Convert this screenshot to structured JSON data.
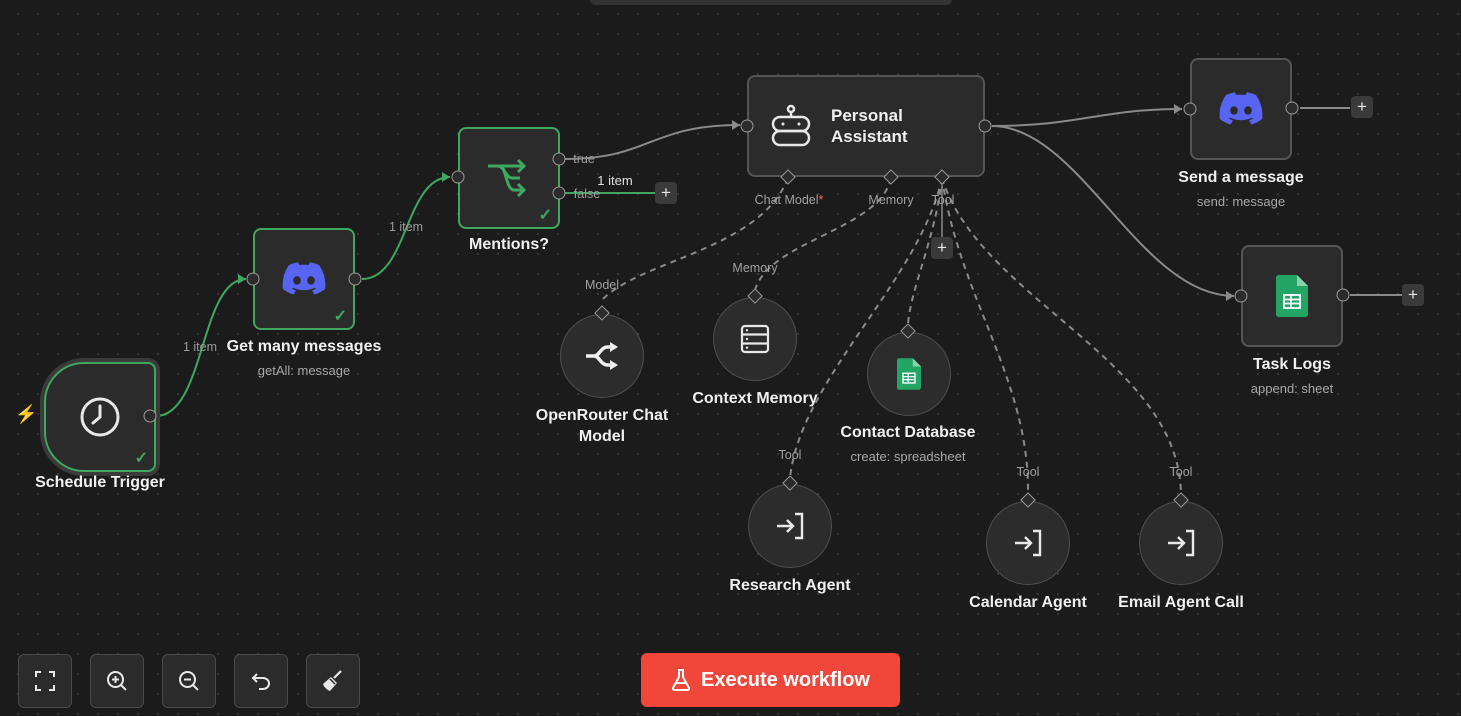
{
  "nodes": {
    "schedule_trigger": {
      "label": "Schedule Trigger"
    },
    "get_messages": {
      "label": "Get many messages",
      "subtitle": "getAll: message"
    },
    "mentions": {
      "label": "Mentions?",
      "true_label": "true",
      "false_label": "false"
    },
    "personal_assistant": {
      "label_line1": "Personal",
      "label_line2": "Assistant",
      "chat_model_port": "Chat Model",
      "chat_model_required": "*",
      "memory_port": "Memory",
      "tool_port": "Tool"
    },
    "send_message": {
      "label": "Send a message",
      "subtitle": "send: message"
    },
    "task_logs": {
      "label": "Task Logs",
      "subtitle": "append: sheet"
    },
    "openrouter": {
      "label_line1": "OpenRouter Chat",
      "label_line2": "Model",
      "port": "Model"
    },
    "context_memory": {
      "label": "Context Memory",
      "port": "Memory"
    },
    "contact_database": {
      "label": "Contact Database",
      "subtitle": "create: spreadsheet"
    },
    "research_agent": {
      "label": "Research Agent",
      "port": "Tool"
    },
    "calendar_agent": {
      "label": "Calendar Agent",
      "port": "Tool"
    },
    "email_agent": {
      "label": "Email Agent Call",
      "port": "Tool"
    }
  },
  "edges": {
    "trigger_to_get": "1 item",
    "get_to_mentions": "1 item",
    "false_branch": "1 item"
  },
  "controls": {
    "fit_view": "fit-view-icon",
    "zoom_in": "zoom-in-icon",
    "zoom_out": "zoom-out-icon",
    "undo": "undo-icon",
    "tidy": "tidy-up-icon"
  },
  "execute_button": {
    "label": "Execute workflow"
  },
  "colors": {
    "accent": "#f0473a",
    "success": "#3ea860",
    "discord": "#5865f2",
    "sheets": "#23a566"
  }
}
